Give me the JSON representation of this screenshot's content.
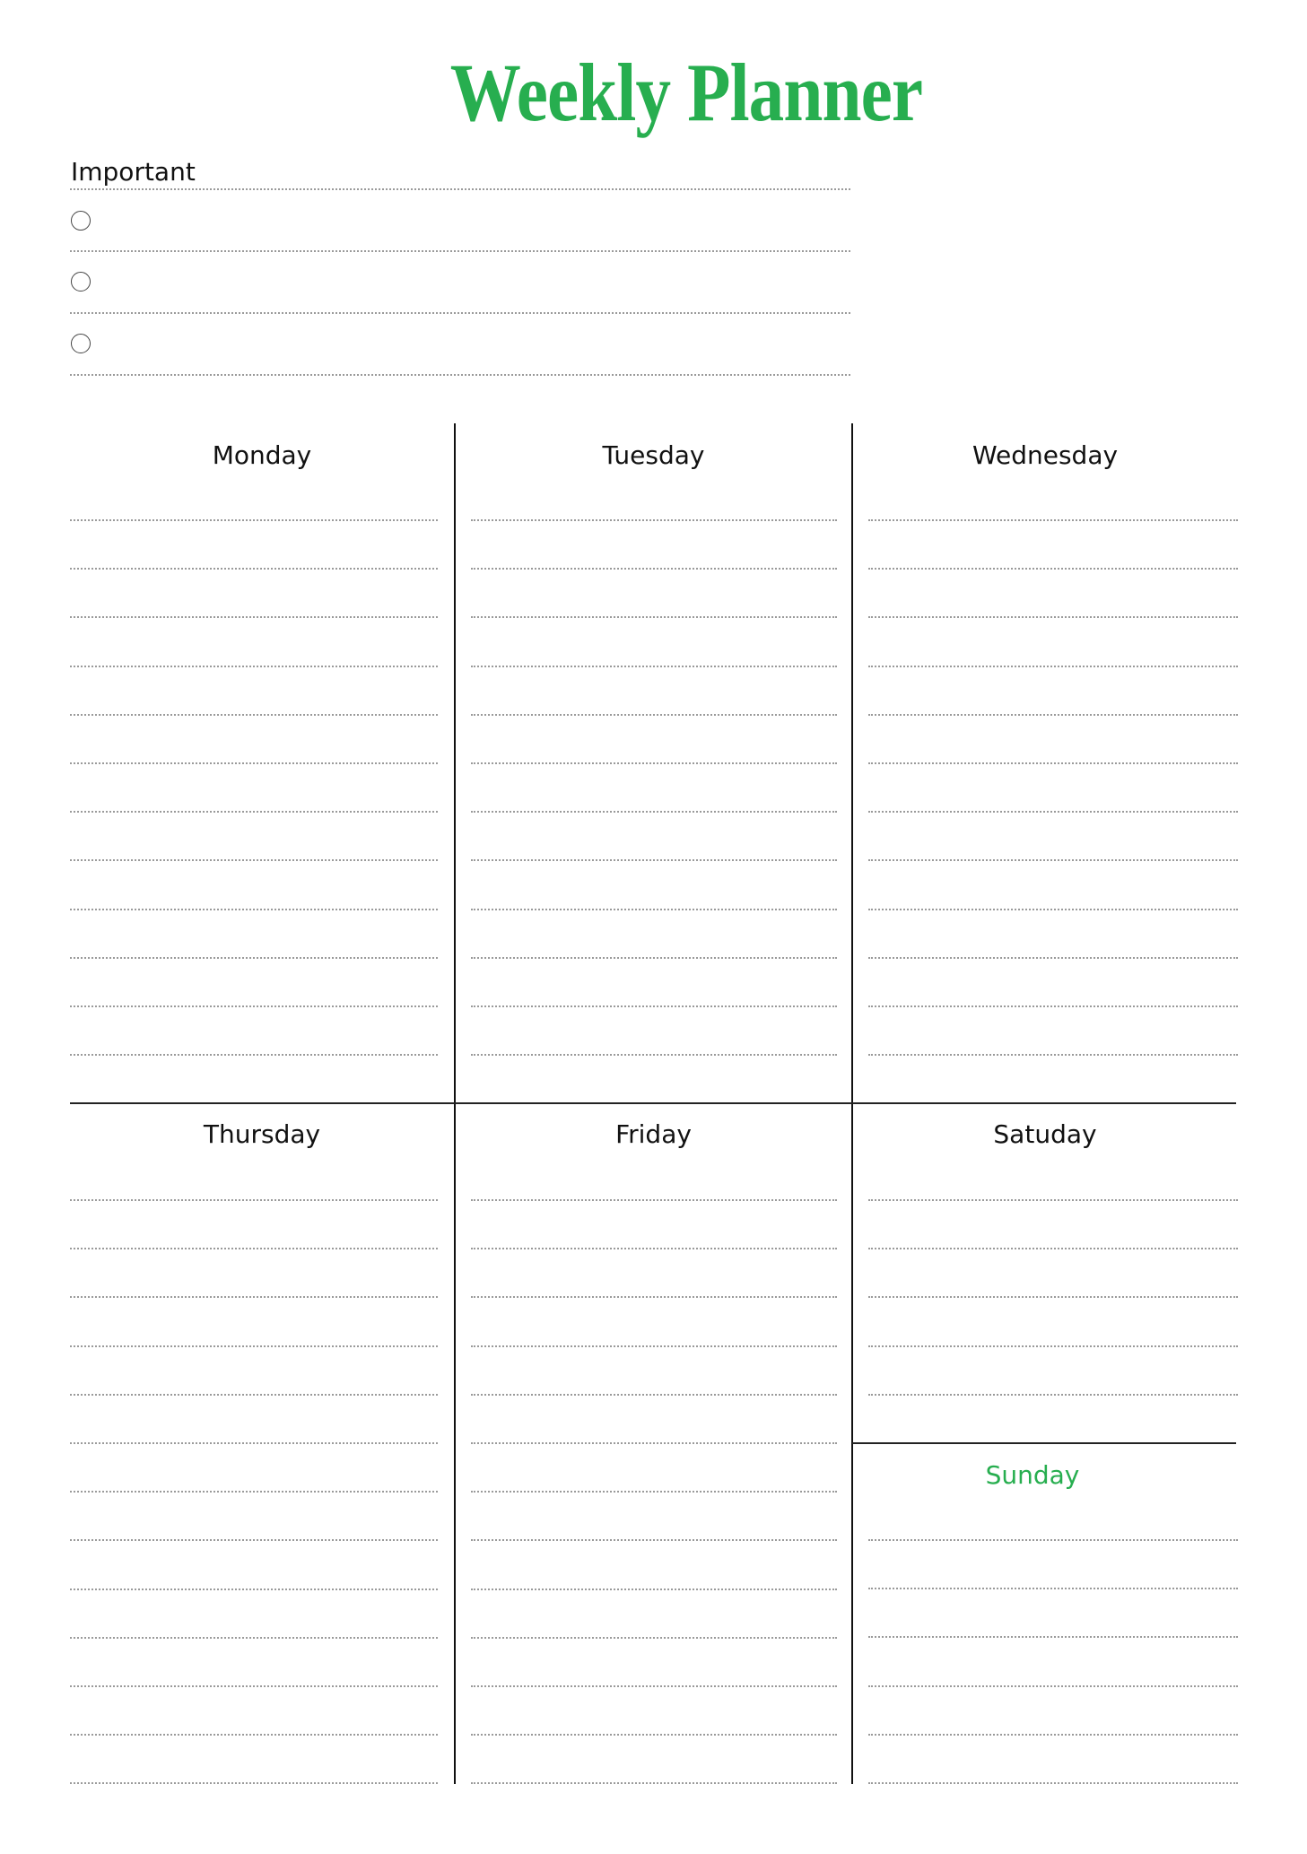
{
  "page": {
    "title": "Weekly Planner",
    "accent_color": "#27ae4f"
  },
  "important": {
    "label": "Important",
    "items": [
      {
        "checked": false,
        "text": ""
      },
      {
        "checked": false,
        "text": ""
      },
      {
        "checked": false,
        "text": ""
      }
    ]
  },
  "days": [
    {
      "label": "Monday",
      "lines": 12
    },
    {
      "label": "Tuesday",
      "lines": 12
    },
    {
      "label": "Wednesday",
      "lines": 12
    },
    {
      "label": "Thursday",
      "lines": 13
    },
    {
      "label": "Friday",
      "lines": 13
    },
    {
      "label": "Satuday",
      "lines": 5
    },
    {
      "label": "Sunday",
      "lines": 6,
      "highlight": true
    }
  ]
}
